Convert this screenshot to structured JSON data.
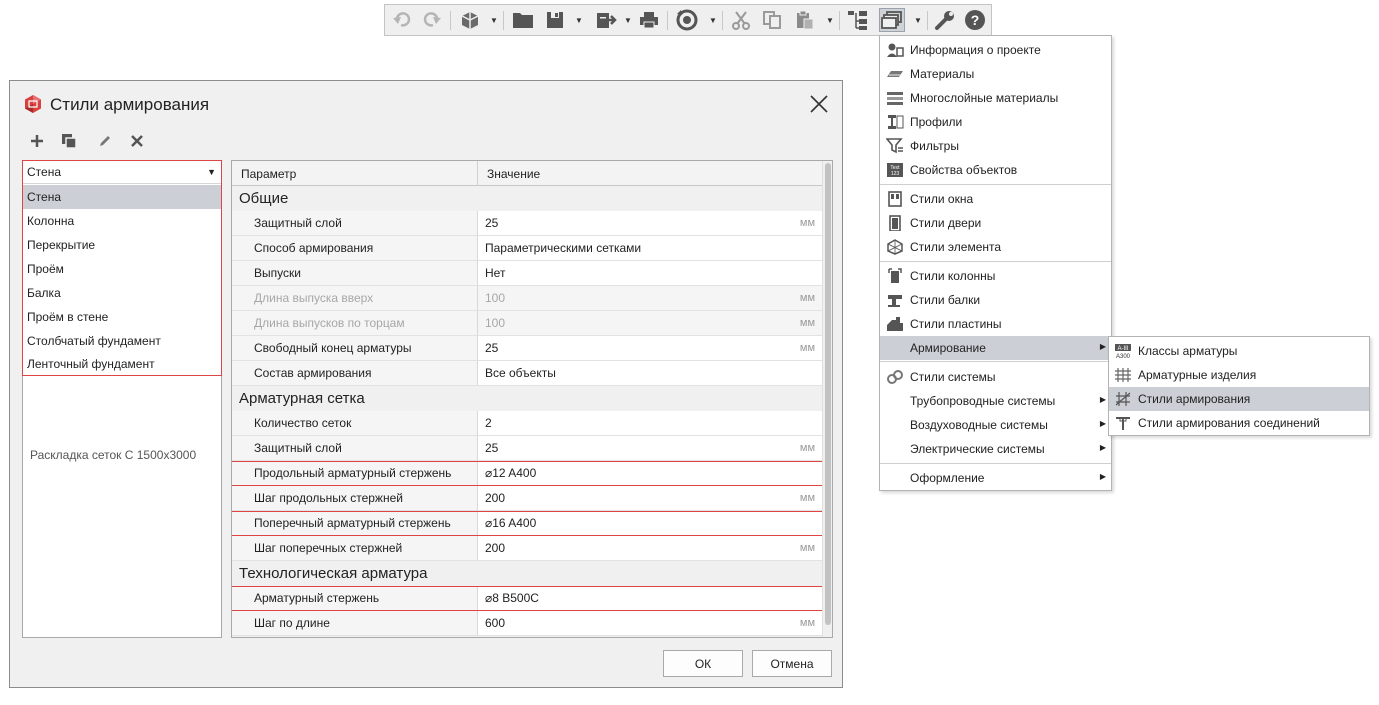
{
  "toolbar": {
    "buttons": [
      "undo-icon",
      "redo-icon",
      "3d-view-icon",
      "open-folder-icon",
      "save-icon",
      "export-icon",
      "print-icon",
      "sync-icon",
      "cut-icon",
      "copy-icon",
      "paste-icon",
      "structure-icon",
      "styles-manager-icon",
      "wrench-icon",
      "help-icon"
    ]
  },
  "dialog": {
    "title": "Стили армирования",
    "close_icon": "close-icon",
    "tools": [
      "add-icon",
      "duplicate-icon",
      "edit-icon",
      "delete-icon"
    ],
    "category": {
      "selected": "Стена",
      "options": [
        "Стена",
        "Колонна",
        "Перекрытие",
        "Проём",
        "Балка",
        "Проём в стене",
        "Столбчатый фундамент",
        "Ленточный фундамент"
      ]
    },
    "style_list_partial": "Раскладка сеток С 1500х3000",
    "grid": {
      "headers": [
        "Параметр",
        "Значение"
      ],
      "rows": [
        {
          "type": "section",
          "name": "Общие"
        },
        {
          "name": "Защитный слой",
          "value": "25",
          "unit": "мм"
        },
        {
          "name": "Способ армирования",
          "value": "Параметрическими сетками",
          "unit": ""
        },
        {
          "name": "Выпуски",
          "value": "Нет",
          "unit": ""
        },
        {
          "name": "Длина выпуска вверх",
          "value": "100",
          "unit": "мм",
          "disabled": true
        },
        {
          "name": "Длина выпусков по торцам",
          "value": "100",
          "unit": "мм",
          "disabled": true
        },
        {
          "name": "Свободный конец арматуры",
          "value": "25",
          "unit": "мм"
        },
        {
          "name": "Состав армирования",
          "value": "Все объекты",
          "unit": ""
        },
        {
          "type": "section",
          "name": "Арматурная сетка"
        },
        {
          "name": "Количество сеток",
          "value": "2",
          "unit": ""
        },
        {
          "name": "Защитный слой",
          "value": "25",
          "unit": "мм"
        },
        {
          "name": "Продольный арматурный стержень",
          "value": "⌀12 A400",
          "unit": "",
          "highlight": true
        },
        {
          "name": "Шаг продольных стержней",
          "value": "200",
          "unit": "мм"
        },
        {
          "name": "Поперечный арматурный стержень",
          "value": "⌀16 A400",
          "unit": "",
          "highlight": true
        },
        {
          "name": "Шаг поперечных стержней",
          "value": "200",
          "unit": "мм"
        },
        {
          "type": "section",
          "name": "Технологическая арматура"
        },
        {
          "name": "Арматурный стержень",
          "value": "⌀8 B500C",
          "unit": "",
          "highlight": true
        },
        {
          "name": "Шаг по длине",
          "value": "600",
          "unit": "мм"
        }
      ]
    },
    "ok_label": "ОК",
    "cancel_label": "Отмена"
  },
  "menu": {
    "items": [
      {
        "label": "Информация о проекте",
        "icon": "project-info-icon"
      },
      {
        "label": "Материалы",
        "icon": "materials-icon"
      },
      {
        "label": "Многослойные материалы",
        "icon": "multilayer-materials-icon"
      },
      {
        "label": "Профили",
        "icon": "profiles-icon"
      },
      {
        "label": "Фильтры",
        "icon": "filters-icon"
      },
      {
        "label": "Свойства объектов",
        "icon": "object-properties-icon"
      },
      {
        "label": "Стили окна",
        "icon": "window-styles-icon"
      },
      {
        "label": "Стили двери",
        "icon": "door-styles-icon"
      },
      {
        "label": "Стили элемента",
        "icon": "element-styles-icon"
      },
      {
        "label": "Стили колонны",
        "icon": "column-styles-icon"
      },
      {
        "label": "Стили балки",
        "icon": "beam-styles-icon"
      },
      {
        "label": "Стили пластины",
        "icon": "plate-styles-icon"
      },
      {
        "label": "Армирование",
        "icon": "",
        "submenu": true,
        "active": true
      },
      {
        "label": "Стили системы",
        "icon": "system-styles-icon"
      },
      {
        "label": "Трубопроводные системы",
        "icon": "",
        "submenu": true
      },
      {
        "label": "Воздуховодные системы",
        "icon": "",
        "submenu": true
      },
      {
        "label": "Электрические системы",
        "icon": "",
        "submenu": true
      },
      {
        "label": "Оформление",
        "icon": "",
        "submenu": true
      }
    ],
    "submenu": [
      {
        "label": "Классы арматуры",
        "icon": "rebar-classes-icon",
        "icon_text": "A-III A300"
      },
      {
        "label": "Арматурные изделия",
        "icon": "rebar-products-icon"
      },
      {
        "label": "Стили армирования",
        "icon": "reinforcement-styles-icon",
        "selected": true
      },
      {
        "label": "Стили армирования соединений",
        "icon": "joint-reinforcement-styles-icon"
      }
    ]
  },
  "colors": {
    "highlight": "#e04545",
    "selection": "#ccd0d6",
    "dialog_bg": "#f0f0f0"
  }
}
